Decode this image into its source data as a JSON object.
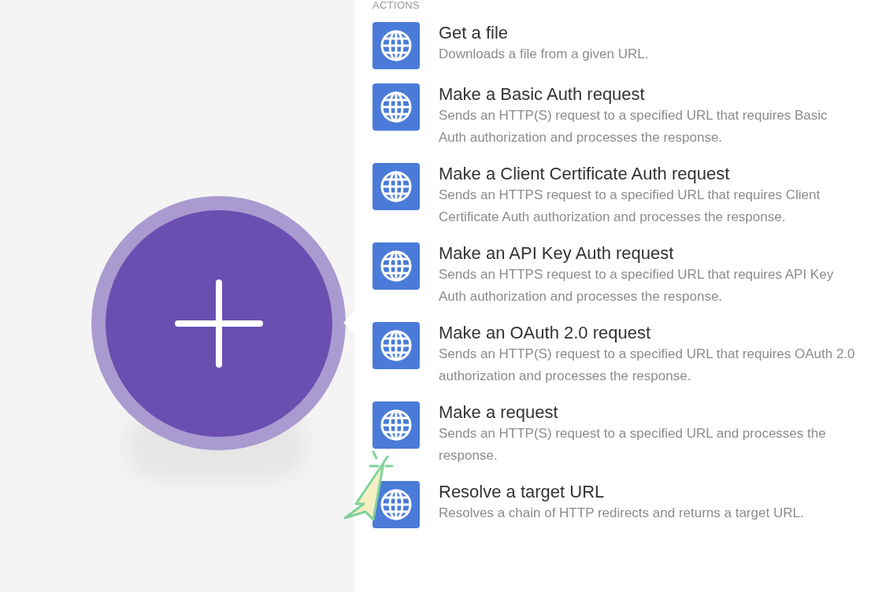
{
  "panel": {
    "heading": "ACTIONS",
    "actions": [
      {
        "title": "Get a file",
        "description": "Downloads a file from a given URL."
      },
      {
        "title": "Make a Basic Auth request",
        "description": "Sends an HTTP(S) request to a specified URL that requires Basic Auth authorization and processes the response."
      },
      {
        "title": "Make a Client Certificate Auth request",
        "description": "Sends an HTTPS request to a specified URL that requires Client Certificate Auth authorization and processes the response."
      },
      {
        "title": "Make an API Key Auth request",
        "description": "Sends an HTTPS request to a specified URL that requires API Key Auth authorization and processes the response."
      },
      {
        "title": "Make an OAuth 2.0 request",
        "description": "Sends an HTTP(S) request to a specified URL that requires OAuth 2.0 authorization and processes the response."
      },
      {
        "title": "Make a request",
        "description": "Sends an HTTP(S) request to a specified URL and processes the response."
      },
      {
        "title": "Resolve a target URL",
        "description": "Resolves a chain of HTTP redirects and returns a target URL."
      }
    ]
  }
}
